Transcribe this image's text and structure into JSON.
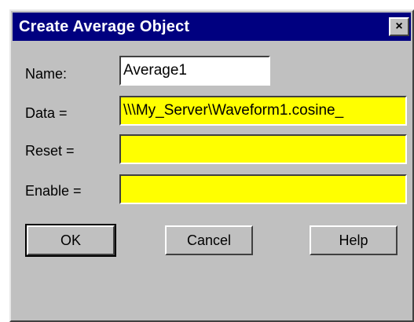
{
  "window": {
    "title": "Create Average Object",
    "close_label": "×"
  },
  "form": {
    "name_label": "Name:",
    "name_value": "Average1",
    "data_label": "Data =",
    "data_value": "\\\\\\My_Server\\Waveform1.cosine_",
    "reset_label": "Reset =",
    "reset_value": "",
    "enable_label": "Enable =",
    "enable_value": ""
  },
  "buttons": {
    "ok_label": "OK",
    "cancel_label": "Cancel",
    "help_label": "Help"
  },
  "colors": {
    "titlebar": "#000080",
    "dialog": "#c0c0c0",
    "highlight_field": "#ffff00"
  },
  "icons": {
    "close": "close-icon"
  }
}
